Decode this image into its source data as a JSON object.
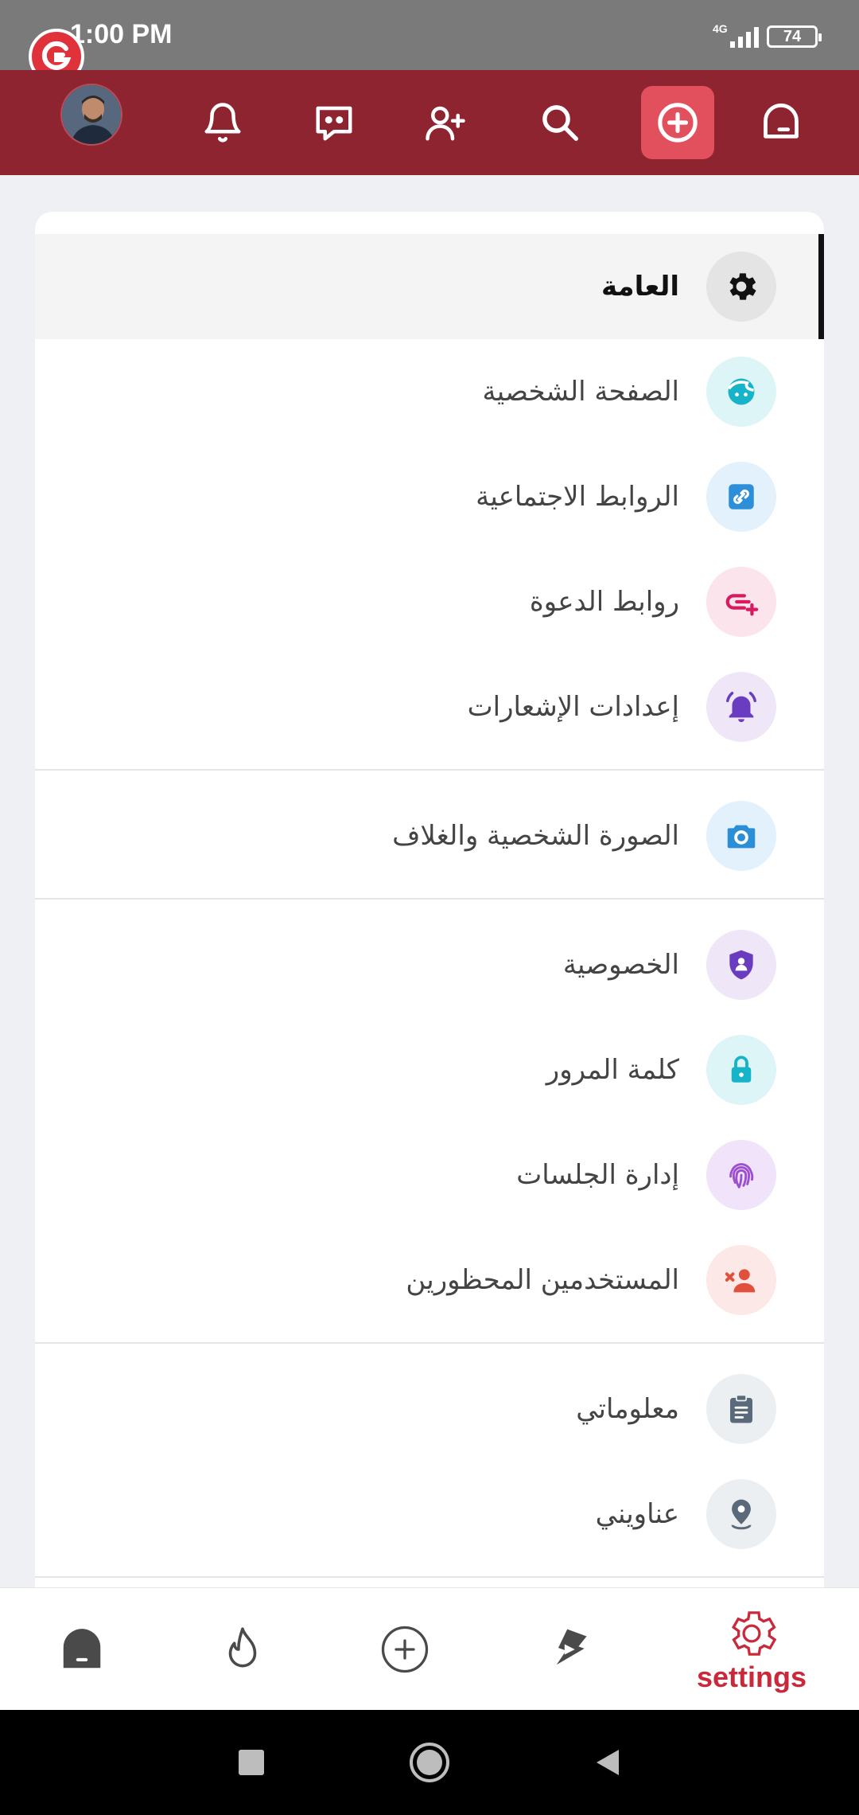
{
  "status_bar": {
    "time": "1:00 PM",
    "network": "4G",
    "battery": "74"
  },
  "top_nav": {
    "icons": [
      "avatar",
      "bell-icon",
      "chat-icon",
      "add-user-icon",
      "search-icon",
      "create-icon",
      "home-icon"
    ],
    "active": "create-icon"
  },
  "menu": {
    "items": [
      {
        "label": "العامة",
        "icon": "gear-icon",
        "active": true
      },
      {
        "label": "الصفحة الشخصية",
        "icon": "face-icon"
      },
      {
        "label": "الروابط الاجتماعية",
        "icon": "link-icon"
      },
      {
        "label": "روابط الدعوة",
        "icon": "invite-link-icon"
      },
      {
        "label": "إعدادات الإشعارات",
        "icon": "notification-bell-icon"
      },
      {
        "label": "الصورة الشخصية والغلاف",
        "icon": "camera-icon"
      },
      {
        "label": "الخصوصية",
        "icon": "shield-icon"
      },
      {
        "label": "كلمة المرور",
        "icon": "lock-icon"
      },
      {
        "label": "إدارة الجلسات",
        "icon": "fingerprint-icon"
      },
      {
        "label": "المستخدمين المحظورين",
        "icon": "blocked-user-icon"
      },
      {
        "label": "معلوماتي",
        "icon": "clipboard-icon"
      },
      {
        "label": "عناويني",
        "icon": "location-pin-icon"
      }
    ]
  },
  "bottom_nav": {
    "items": [
      {
        "icon": "home-icon"
      },
      {
        "icon": "fire-icon"
      },
      {
        "icon": "add-icon"
      },
      {
        "icon": "video-icon"
      },
      {
        "icon": "settings-icon",
        "label": "settings",
        "active": true
      }
    ]
  },
  "colors": {
    "header": "#8e2430",
    "accent": "#c9293a",
    "status_bar": "#7a7a7a"
  }
}
